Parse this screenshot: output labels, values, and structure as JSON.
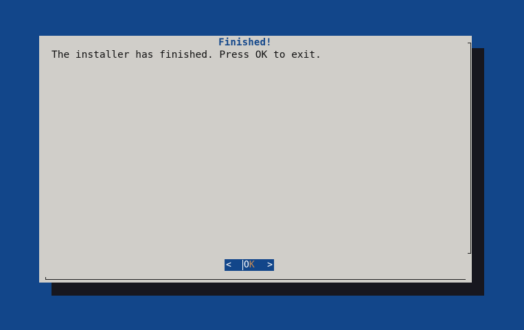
{
  "dialog": {
    "title": "Finished!",
    "message": "The installer has finished. Press OK to exit.",
    "ok_button": {
      "left_bracket": "<",
      "hotkey": "O",
      "rest": "K",
      "right_bracket": ">"
    }
  },
  "colors": {
    "background": "#12468a",
    "dialog_bg": "#d0cec9",
    "shadow": "#17171f",
    "title": "#12468a",
    "button_bg": "#12468a"
  }
}
